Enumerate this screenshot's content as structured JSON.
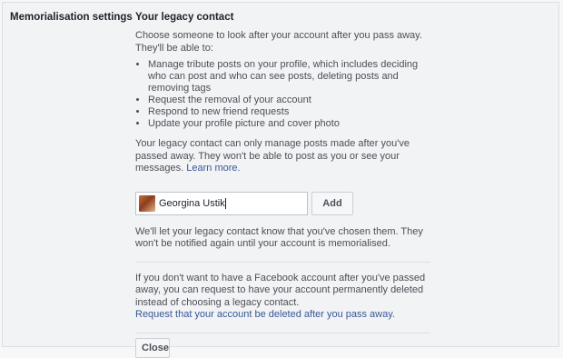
{
  "section_label": "Memorialisation settings",
  "legacy": {
    "heading": "Your legacy contact",
    "intro": "Choose someone to look after your account after you pass away. They'll be able to:",
    "bullets": [
      "Manage tribute posts on your profile, which includes deciding who can post and who can see posts, deleting posts and removing tags",
      "Request the removal of your account",
      "Respond to new friend requests",
      "Update your profile picture and cover photo"
    ],
    "note": "Your legacy contact can only manage posts made after you've passed away. They won't be able to post as you or see your messages.",
    "learn_more": "Learn more.",
    "input_value": "Georgina Ustik",
    "add_label": "Add",
    "notify": "We'll let your legacy contact know that you've chosen them. They won't be notified again until your account is memorialised."
  },
  "deletion": {
    "text": "If you don't want to have a Facebook account after you've passed away, you can request to have your account permanently deleted instead of choosing a legacy contact.",
    "link": "Request that your account be deleted after you pass away."
  },
  "close_label": "Close"
}
